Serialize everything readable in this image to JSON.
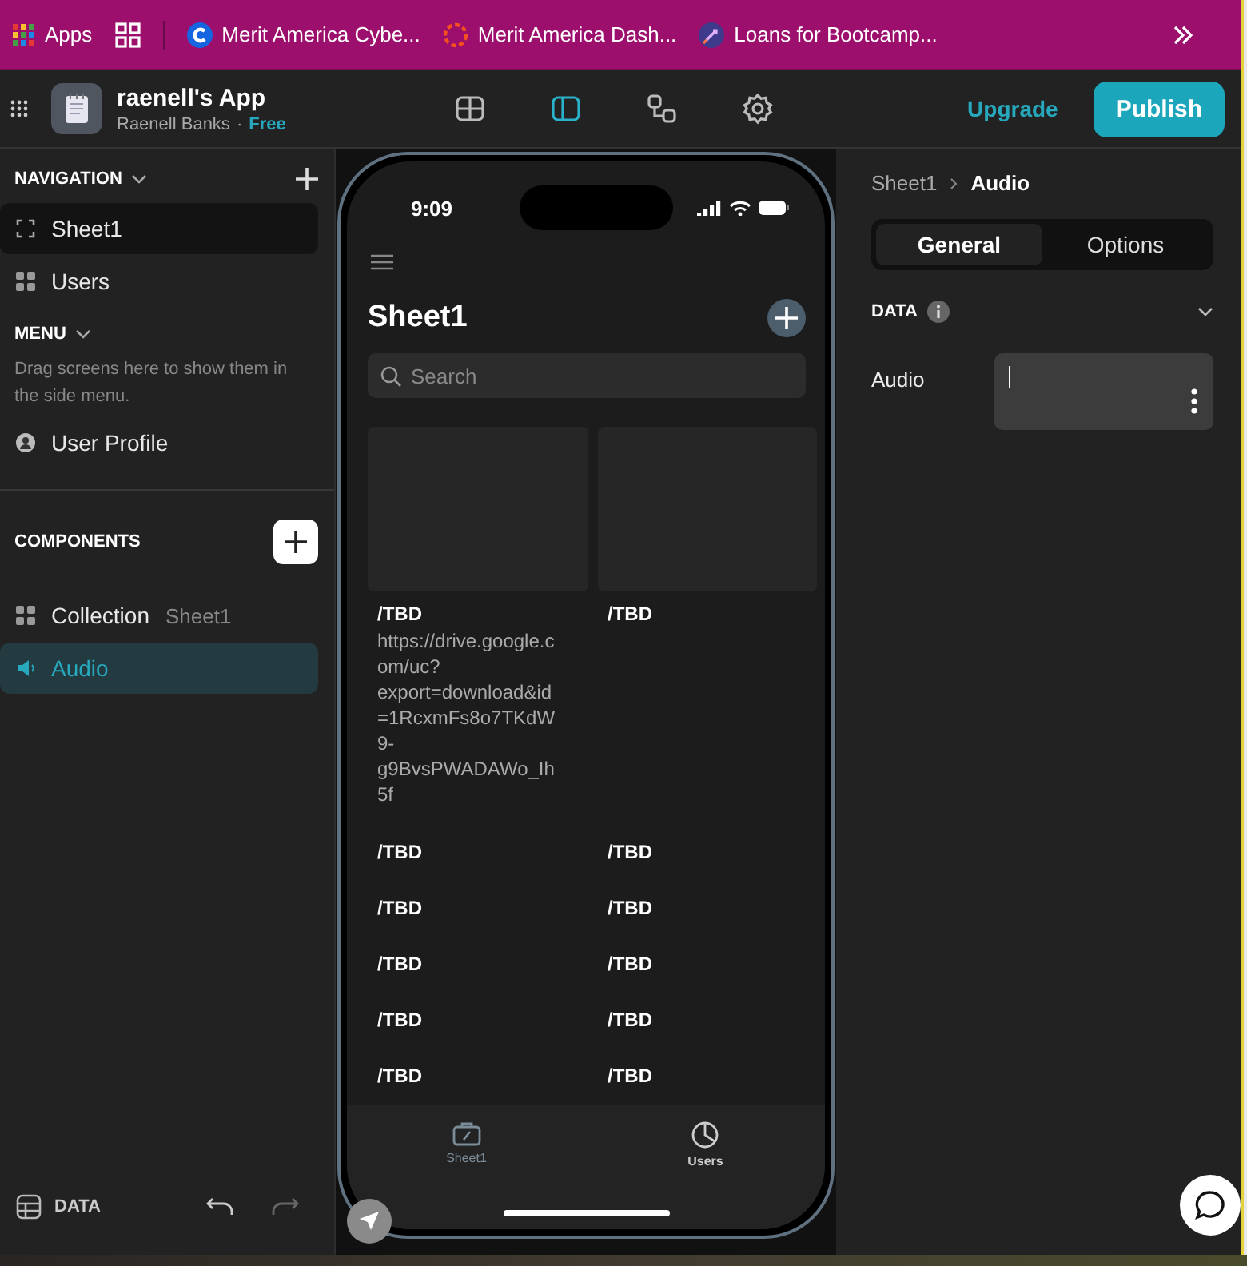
{
  "bookmarks": [
    {
      "kind": "apps",
      "label": "Apps"
    },
    {
      "kind": "grid"
    },
    {
      "kind": "c",
      "label": "Merit America Cybe..."
    },
    {
      "kind": "ring",
      "label": "Merit America Dash..."
    },
    {
      "kind": "rocket",
      "label": "Loans for Bootcamp..."
    }
  ],
  "header": {
    "app_name": "raenell's App",
    "owner": "Raenell Banks",
    "separator": "·",
    "plan": "Free",
    "modes": [
      {
        "kind": "data",
        "selected": false
      },
      {
        "kind": "layout",
        "selected": true
      },
      {
        "kind": "workflow",
        "selected": false
      },
      {
        "kind": "settings",
        "selected": false
      }
    ],
    "upgrade": "Upgrade",
    "publish": "Publish"
  },
  "navigation": {
    "title": "NAVIGATION",
    "items": [
      {
        "label": "Sheet1",
        "kind": "screen",
        "selected": true
      },
      {
        "label": "Users",
        "kind": "grid",
        "selected": false
      }
    ]
  },
  "menu": {
    "title": "MENU",
    "hint": "Drag screens here to show them in the side menu.",
    "items": [
      {
        "label": "User Profile",
        "kind": "user"
      }
    ]
  },
  "components": {
    "title": "COMPONENTS",
    "items": [
      {
        "label": "Collection",
        "detail": "Sheet1",
        "kind": "grid",
        "selected": false
      },
      {
        "label": "Audio",
        "kind": "speaker",
        "selected": true
      }
    ]
  },
  "footer": {
    "data_label": "DATA"
  },
  "phone": {
    "time": "9:09",
    "title": "Sheet1",
    "search": {
      "placeholder": "Search"
    },
    "items": [
      {
        "image": true,
        "title": "/TBD",
        "subtitle": "https://drive.google.com/uc?export=download&id=1RcxmFs8o7TKdW9-g9BvsPWADAWo_Ih5f"
      },
      {
        "image": true,
        "title": "/TBD"
      },
      {
        "image": false,
        "title": "/TBD"
      },
      {
        "image": false,
        "title": "/TBD"
      },
      {
        "image": false,
        "title": "/TBD"
      },
      {
        "image": false,
        "title": "/TBD"
      },
      {
        "image": false,
        "title": "/TBD"
      },
      {
        "image": false,
        "title": "/TBD"
      },
      {
        "image": false,
        "title": "/TBD"
      },
      {
        "image": false,
        "title": "/TBD"
      },
      {
        "image": false,
        "title": "/TBD"
      },
      {
        "image": false,
        "title": "/TBD"
      }
    ],
    "tabs": [
      {
        "label": "Sheet1",
        "kind": "bag",
        "selected": true
      },
      {
        "label": "Users",
        "kind": "chart",
        "selected": false
      }
    ]
  },
  "inspector": {
    "breadcrumb": [
      "Sheet1",
      "Audio"
    ],
    "tabs": [
      {
        "label": "General",
        "selected": true
      },
      {
        "label": "Options",
        "selected": false
      }
    ],
    "section": "DATA",
    "fields": [
      {
        "label": "Audio"
      }
    ]
  }
}
